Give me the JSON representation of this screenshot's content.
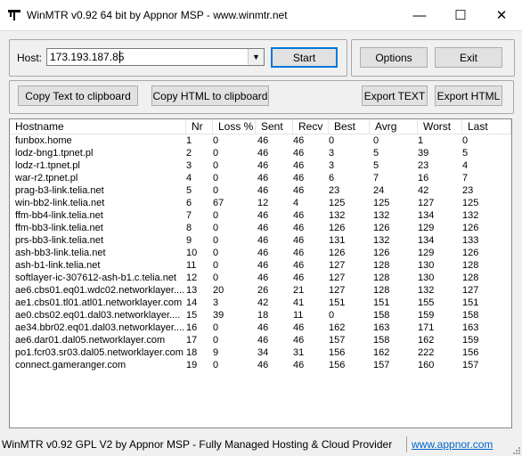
{
  "window": {
    "title": "WinMTR v0.92 64 bit by Appnor MSP - www.winmtr.net",
    "minimize_glyph": "—",
    "maximize_glyph": "☐",
    "close_glyph": "✕"
  },
  "host": {
    "label": "Host:",
    "value": "173.193.187.85",
    "dropdown_glyph": "▼"
  },
  "buttons": {
    "start": "Start",
    "options": "Options",
    "exit": "Exit",
    "copy_text": "Copy Text to clipboard",
    "copy_html": "Copy HTML to clipboard",
    "export_text": "Export TEXT",
    "export_html": "Export HTML"
  },
  "table": {
    "columns": [
      "Hostname",
      "Nr",
      "Loss %",
      "Sent",
      "Recv",
      "Best",
      "Avrg",
      "Worst",
      "Last"
    ],
    "rows": [
      [
        "funbox.home",
        "1",
        "0",
        "46",
        "46",
        "0",
        "0",
        "1",
        "0"
      ],
      [
        "lodz-bng1.tpnet.pl",
        "2",
        "0",
        "46",
        "46",
        "3",
        "5",
        "39",
        "5"
      ],
      [
        "lodz-r1.tpnet.pl",
        "3",
        "0",
        "46",
        "46",
        "3",
        "5",
        "23",
        "4"
      ],
      [
        "war-r2.tpnet.pl",
        "4",
        "0",
        "46",
        "46",
        "6",
        "7",
        "16",
        "7"
      ],
      [
        "prag-b3-link.telia.net",
        "5",
        "0",
        "46",
        "46",
        "23",
        "24",
        "42",
        "23"
      ],
      [
        "win-bb2-link.telia.net",
        "6",
        "67",
        "12",
        "4",
        "125",
        "125",
        "127",
        "125"
      ],
      [
        "ffm-bb4-link.telia.net",
        "7",
        "0",
        "46",
        "46",
        "132",
        "132",
        "134",
        "132"
      ],
      [
        "ffm-bb3-link.telia.net",
        "8",
        "0",
        "46",
        "46",
        "126",
        "126",
        "129",
        "126"
      ],
      [
        "prs-bb3-link.telia.net",
        "9",
        "0",
        "46",
        "46",
        "131",
        "132",
        "134",
        "133"
      ],
      [
        "ash-bb3-link.telia.net",
        "10",
        "0",
        "46",
        "46",
        "126",
        "126",
        "129",
        "126"
      ],
      [
        "ash-b1-link.telia.net",
        "11",
        "0",
        "46",
        "46",
        "127",
        "128",
        "130",
        "128"
      ],
      [
        "softlayer-ic-307612-ash-b1.c.telia.net",
        "12",
        "0",
        "46",
        "46",
        "127",
        "128",
        "130",
        "128"
      ],
      [
        "ae6.cbs01.eq01.wdc02.networklayer....",
        "13",
        "20",
        "26",
        "21",
        "127",
        "128",
        "132",
        "127"
      ],
      [
        "ae1.cbs01.tl01.atl01.networklayer.com",
        "14",
        "3",
        "42",
        "41",
        "151",
        "151",
        "155",
        "151"
      ],
      [
        "ae0.cbs02.eq01.dal03.networklayer....",
        "15",
        "39",
        "18",
        "11",
        "0",
        "158",
        "159",
        "158"
      ],
      [
        "ae34.bbr02.eq01.dal03.networklayer....",
        "16",
        "0",
        "46",
        "46",
        "162",
        "163",
        "171",
        "163"
      ],
      [
        "ae6.dar01.dal05.networklayer.com",
        "17",
        "0",
        "46",
        "46",
        "157",
        "158",
        "162",
        "159"
      ],
      [
        "po1.fcr03.sr03.dal05.networklayer.com",
        "18",
        "9",
        "34",
        "31",
        "156",
        "162",
        "222",
        "156"
      ],
      [
        "connect.gameranger.com",
        "19",
        "0",
        "46",
        "46",
        "156",
        "157",
        "160",
        "157"
      ]
    ]
  },
  "status": {
    "text": "WinMTR v0.92 GPL V2 by Appnor MSP - Fully Managed Hosting & Cloud Provider",
    "link": "www.appnor.com"
  }
}
